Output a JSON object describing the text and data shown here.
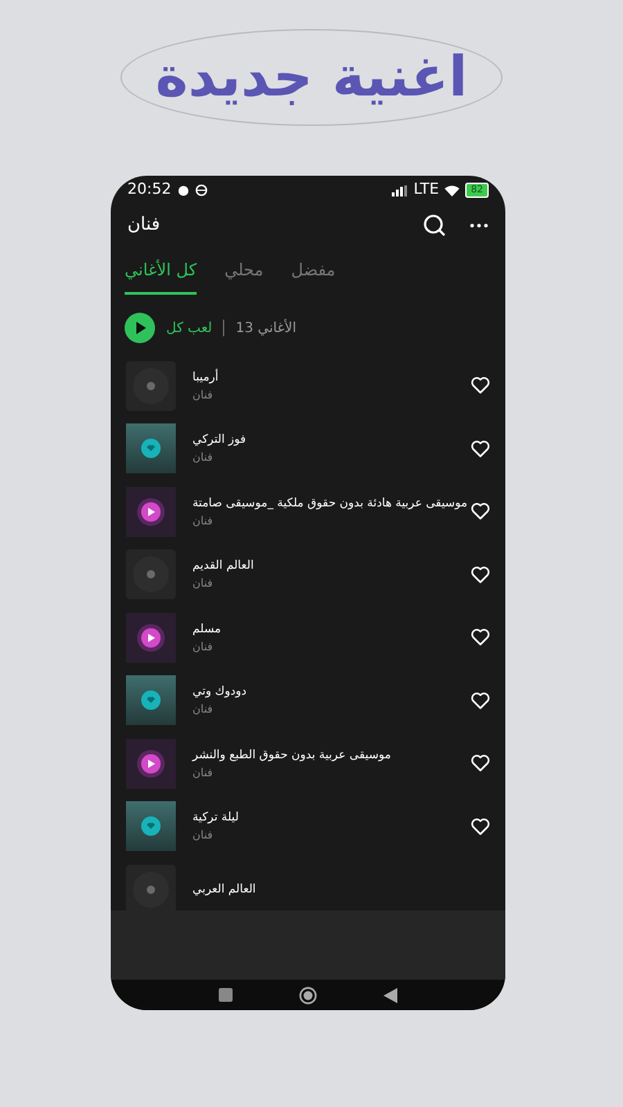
{
  "headline": "اغنية جديدة",
  "status_bar": {
    "time": "20:52",
    "network": "LTE",
    "battery": "82"
  },
  "app_bar": {
    "title": "فنان"
  },
  "tabs": [
    {
      "label": "مفضل",
      "selected": false
    },
    {
      "label": "محلي",
      "selected": false
    },
    {
      "label": "كل الأغاني",
      "selected": true
    }
  ],
  "play_all": {
    "label": "لعب كل",
    "count": "الأغاني 13"
  },
  "songs": [
    {
      "title": "أرميبا",
      "artist": "فنان",
      "kind": "disc"
    },
    {
      "title": "فوز التركي",
      "artist": "فنان",
      "kind": "teal"
    },
    {
      "title": "موسيقى عربية هادئة بدون حقوق ملكية _موسيقى صامتة",
      "artist": "فنان",
      "kind": "purple"
    },
    {
      "title": "العالم القديم",
      "artist": "فنان",
      "kind": "disc"
    },
    {
      "title": "مسلم",
      "artist": "فنان",
      "kind": "purple"
    },
    {
      "title": "دودوك وتي",
      "artist": "فنان",
      "kind": "teal"
    },
    {
      "title": "موسيقى عربية بدون حقوق الطبع والنشر",
      "artist": "فنان",
      "kind": "purple"
    },
    {
      "title": "ليلة تركية",
      "artist": "فنان",
      "kind": "teal"
    },
    {
      "title": "العالم العربي",
      "kind": "disc"
    }
  ]
}
